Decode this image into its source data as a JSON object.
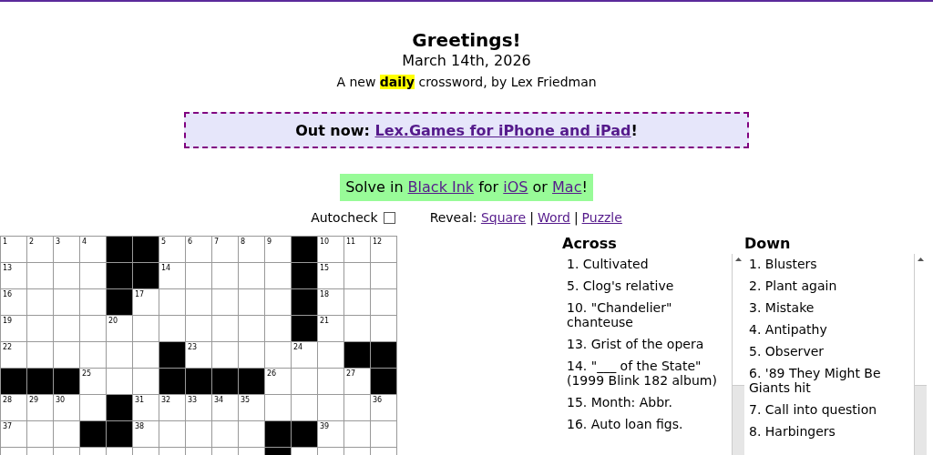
{
  "header": {
    "title": "Greetings!",
    "date": "March 14th, 2026",
    "byline": "A new **daily** crossword, by Lex Friedman"
  },
  "banner": {
    "before": "Out now: ",
    "link": "Lex.Games for iPhone and iPad",
    "after": "!"
  },
  "solve": [
    {
      "kind": "text",
      "text": "Solve in "
    },
    {
      "kind": "link",
      "text": "Black Ink"
    },
    {
      "kind": "text",
      "text": " for "
    },
    {
      "kind": "link",
      "text": "iOS"
    },
    {
      "kind": "text",
      "text": " or "
    },
    {
      "kind": "link",
      "text": "Mac"
    },
    {
      "kind": "text",
      "text": "!"
    }
  ],
  "autocheck": {
    "label": "Autocheck",
    "checked": false
  },
  "reveal": {
    "label": "Reveal:",
    "links": [
      "Square",
      "Word",
      "Puzzle"
    ],
    "separator": "|"
  },
  "grid": {
    "rows": [
      [
        {
          "black": false,
          "number": "1"
        },
        {
          "black": false,
          "number": "2"
        },
        {
          "black": false,
          "number": "3"
        },
        {
          "black": false,
          "number": "4"
        },
        {
          "black": true
        },
        {
          "black": true
        },
        {
          "black": false,
          "number": "5"
        },
        {
          "black": false,
          "number": "6"
        },
        {
          "black": false,
          "number": "7"
        },
        {
          "black": false,
          "number": "8"
        },
        {
          "black": false,
          "number": "9"
        },
        {
          "black": true
        },
        {
          "black": false,
          "number": "10"
        },
        {
          "black": false,
          "number": "11"
        },
        {
          "black": false,
          "number": "12"
        }
      ],
      [
        {
          "black": false,
          "number": "13"
        },
        {
          "black": false
        },
        {
          "black": false
        },
        {
          "black": false
        },
        {
          "black": true
        },
        {
          "black": true
        },
        {
          "black": false,
          "number": "14"
        },
        {
          "black": false
        },
        {
          "black": false
        },
        {
          "black": false
        },
        {
          "black": false
        },
        {
          "black": true
        },
        {
          "black": false,
          "number": "15"
        },
        {
          "black": false
        },
        {
          "black": false
        }
      ],
      [
        {
          "black": false,
          "number": "16"
        },
        {
          "black": false
        },
        {
          "black": false
        },
        {
          "black": false
        },
        {
          "black": true
        },
        {
          "black": false,
          "number": "17"
        },
        {
          "black": false
        },
        {
          "black": false
        },
        {
          "black": false
        },
        {
          "black": false
        },
        {
          "black": false
        },
        {
          "black": true
        },
        {
          "black": false,
          "number": "18"
        },
        {
          "black": false
        },
        {
          "black": false
        }
      ],
      [
        {
          "black": false,
          "number": "19"
        },
        {
          "black": false
        },
        {
          "black": false
        },
        {
          "black": false
        },
        {
          "black": false,
          "number": "20"
        },
        {
          "black": false
        },
        {
          "black": false
        },
        {
          "black": false
        },
        {
          "black": false
        },
        {
          "black": false
        },
        {
          "black": false
        },
        {
          "black": true
        },
        {
          "black": false,
          "number": "21"
        },
        {
          "black": false
        },
        {
          "black": false
        }
      ],
      [
        {
          "black": false,
          "number": "22"
        },
        {
          "black": false
        },
        {
          "black": false
        },
        {
          "black": false
        },
        {
          "black": false
        },
        {
          "black": false
        },
        {
          "black": true
        },
        {
          "black": false,
          "number": "23"
        },
        {
          "black": false
        },
        {
          "black": false
        },
        {
          "black": false
        },
        {
          "black": false,
          "number": "24"
        },
        {
          "black": false
        },
        {
          "black": true
        },
        {
          "black": true
        }
      ],
      [
        {
          "black": true
        },
        {
          "black": true
        },
        {
          "black": true
        },
        {
          "black": false,
          "number": "25"
        },
        {
          "black": false
        },
        {
          "black": false
        },
        {
          "black": true
        },
        {
          "black": true
        },
        {
          "black": true
        },
        {
          "black": true
        },
        {
          "black": false,
          "number": "26"
        },
        {
          "black": false
        },
        {
          "black": false
        },
        {
          "black": false,
          "number": "27"
        },
        {
          "black": true
        }
      ],
      [
        {
          "black": false,
          "number": "28"
        },
        {
          "black": false,
          "number": "29"
        },
        {
          "black": false,
          "number": "30"
        },
        {
          "black": false
        },
        {
          "black": true
        },
        {
          "black": false,
          "number": "31"
        },
        {
          "black": false,
          "number": "32"
        },
        {
          "black": false,
          "number": "33"
        },
        {
          "black": false,
          "number": "34"
        },
        {
          "black": false,
          "number": "35"
        },
        {
          "black": false
        },
        {
          "black": false
        },
        {
          "black": false
        },
        {
          "black": false
        },
        {
          "black": false,
          "number": "36"
        }
      ],
      [
        {
          "black": false,
          "number": "37"
        },
        {
          "black": false
        },
        {
          "black": false
        },
        {
          "black": true
        },
        {
          "black": true
        },
        {
          "black": false,
          "number": "38"
        },
        {
          "black": false
        },
        {
          "black": false
        },
        {
          "black": false
        },
        {
          "black": false
        },
        {
          "black": true
        },
        {
          "black": true
        },
        {
          "black": false,
          "number": "39"
        },
        {
          "black": false
        },
        {
          "black": false
        }
      ],
      [
        {
          "black": false
        },
        {
          "black": false
        },
        {
          "black": false
        },
        {
          "black": false
        },
        {
          "black": false
        },
        {
          "black": false
        },
        {
          "black": false
        },
        {
          "black": false
        },
        {
          "black": false
        },
        {
          "black": false
        },
        {
          "black": true
        },
        {
          "black": false
        },
        {
          "black": false
        },
        {
          "black": false
        },
        {
          "black": false
        }
      ]
    ]
  },
  "clues": [
    {
      "heading": "Across",
      "items": [
        "1. Cultivated",
        "5. Clog's relative",
        "10. \"Chandelier\" chanteuse",
        "13. Grist of the opera",
        "14. \"___ of the State\" (1999 Blink 182 album)",
        "15. Month: Abbr.",
        "16. Auto loan figs."
      ]
    },
    {
      "heading": "Down",
      "items": [
        "1. Blusters",
        "2. Plant again",
        "3. Mistake",
        "4. Antipathy",
        "5. Observer",
        "6. '89 They Might Be Giants hit",
        "7. Call into question",
        "8. Harbingers"
      ]
    }
  ]
}
